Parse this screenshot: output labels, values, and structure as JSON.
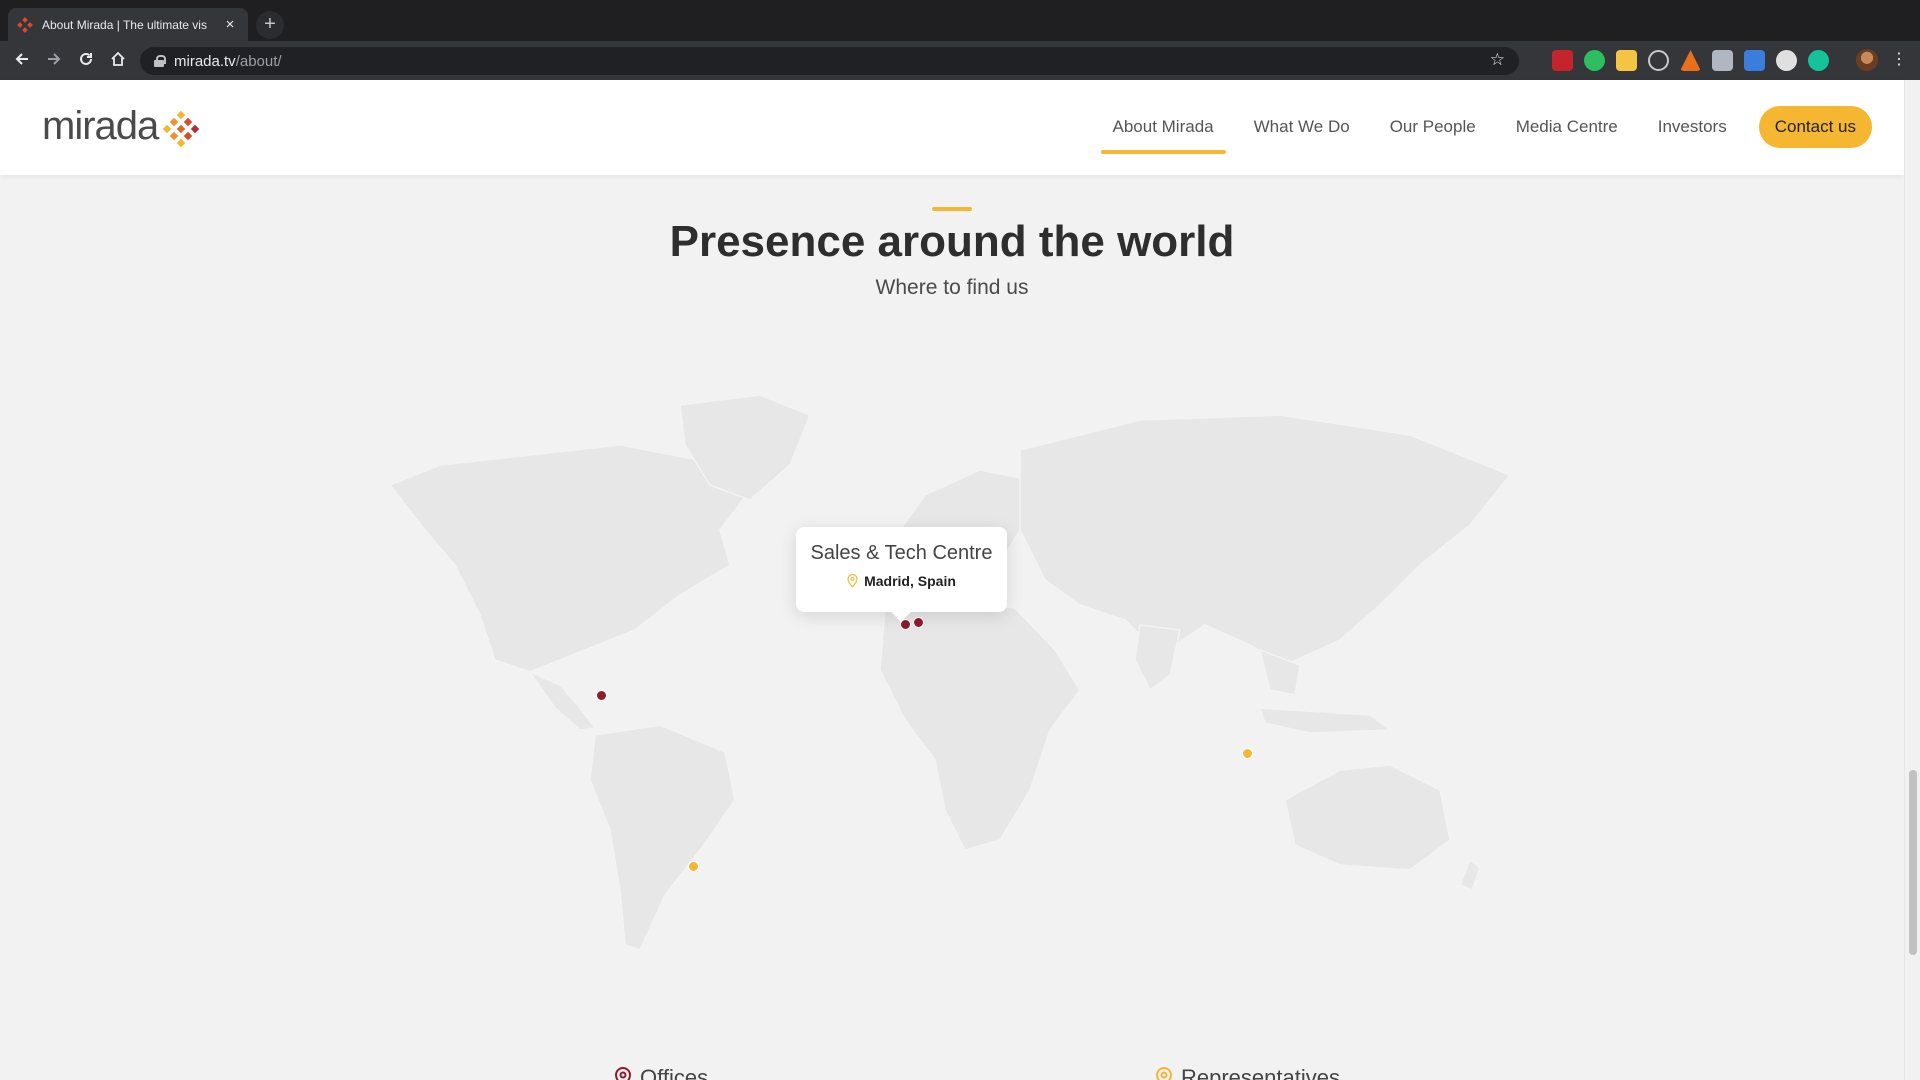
{
  "browser": {
    "tab_title": "About Mirada | The ultimate vis",
    "tab_close": "×",
    "new_tab": "+",
    "url_domain": "mirada.tv",
    "url_path": "/about/",
    "extensions": [
      "abp-icon",
      "evernote-icon",
      "notes-icon",
      "target-icon",
      "fire-icon",
      "chat-icon",
      "translate-icon",
      "cloud-icon",
      "grammarly-icon"
    ]
  },
  "site": {
    "logo_text": "mirada",
    "nav": [
      {
        "label": "About Mirada",
        "active": true
      },
      {
        "label": "What We Do"
      },
      {
        "label": "Our People"
      },
      {
        "label": "Media Centre"
      },
      {
        "label": "Investors"
      }
    ],
    "contact_label": "Contact us",
    "accent_color": "#f5b731",
    "office_color": "#8e1b2b"
  },
  "section": {
    "title": "Presence around the world",
    "subtitle": "Where to find us"
  },
  "tooltip": {
    "title": "Sales & Tech Centre",
    "location": "Madrid, Spain"
  },
  "legend": {
    "offices": "Offices",
    "representatives": "Representatives"
  }
}
